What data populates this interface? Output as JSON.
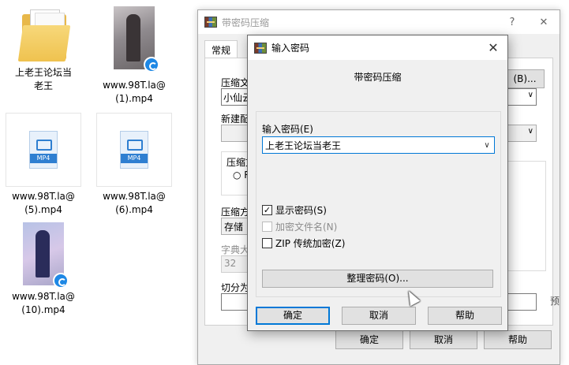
{
  "desktop": {
    "icons": [
      {
        "label": "上老王论坛当老王"
      },
      {
        "label": "www.98T.la@\n(1).mp4"
      },
      {
        "label": "www.98T.la@\n(5).mp4",
        "badge": "MP4"
      },
      {
        "label": "www.98T.la@\n(6).mp4",
        "badge": "MP4"
      },
      {
        "label": "www.98T.la@\n(10).mp4"
      }
    ]
  },
  "back_window": {
    "title": "带密码压缩",
    "help_glyph": "?",
    "close_glyph": "✕",
    "tab_general": "常规",
    "label_archive": "压缩文",
    "archive_value": "小仙云",
    "label_new": "新建配",
    "label_format": "压缩文",
    "radio_opt": "○ R",
    "label_method": "压缩方",
    "method_value": "存储",
    "label_dict": "字典大",
    "dict_value": "32",
    "label_split": "切分为",
    "browse_label": "(B)...",
    "ok_label": "确定",
    "cancel_label": "取消",
    "help_label": "帮助",
    "edge_text": "预"
  },
  "dialog": {
    "title": "输入密码",
    "close_glyph": "✕",
    "heading": "带密码压缩",
    "password_label": "输入密码(E)",
    "password_value": "上老王论坛当老王",
    "show_password_label": "显示密码(S)",
    "show_password_checked": true,
    "check_glyph": "✓",
    "encrypt_names_label": "加密文件名(N)",
    "encrypt_names_checked": false,
    "zip_legacy_label": "ZIP 传统加密(Z)",
    "zip_legacy_checked": false,
    "organize_label": "整理密码(O)...",
    "ok_label": "确定",
    "cancel_label": "取消",
    "help_label": "帮助"
  }
}
